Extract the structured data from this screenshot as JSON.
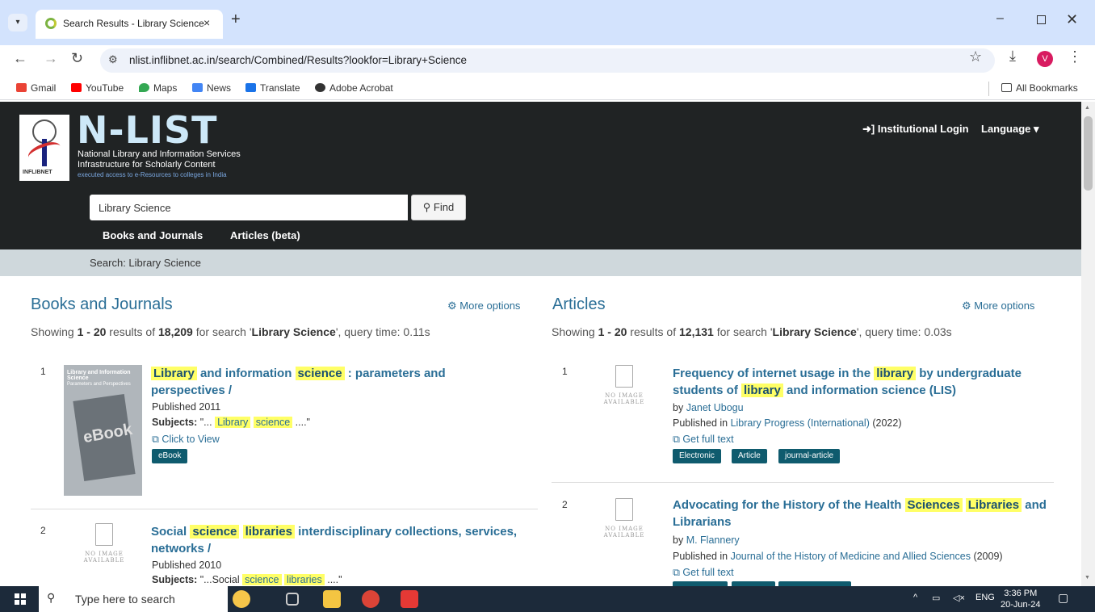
{
  "browser": {
    "tab_title": "Search Results - Library Science",
    "tab_close": "×",
    "new_tab": "+",
    "url": "nlist.inflibnet.ac.in/search/Combined/Results?lookfor=Library+Science",
    "profile_initial": "V",
    "bookmarks": [
      "Gmail",
      "YouTube",
      "Maps",
      "News",
      "Translate",
      "Adobe Acrobat"
    ],
    "all_bookmarks": "All Bookmarks"
  },
  "site": {
    "brand": "N-LIST",
    "tagline1": "National Library and Information Services",
    "tagline2": "Infrastructure for Scholarly Content",
    "tagline3": "executed access to e-Resources to colleges in India",
    "logo_text": "INFLIBNET",
    "login": "Institutional Login",
    "language": "Language",
    "search_value": "Library Science",
    "find": "Find",
    "tabs": [
      "Books and Journals",
      "Articles (beta)"
    ],
    "breadcrumb": "Search: Library Science"
  },
  "books": {
    "title": "Books and Journals",
    "more_options": "More options",
    "showing_prefix": "Showing ",
    "range": "1 - 20",
    "results_of": " results of ",
    "total": "18,209",
    "for_search": " for search '",
    "query": "Library Science",
    "time": "', query time: 0.11s",
    "results": [
      {
        "num": "1",
        "title_parts": [
          "Library",
          " and information ",
          "science",
          " : parameters and perspectives /"
        ],
        "published": "Published 2011",
        "subjects_label": "Subjects:",
        "subjects_pre": " \"... ",
        "subj_hl1": "Library",
        "subj_hl2": "science",
        "subjects_post": " ....\"",
        "link": "Click to View",
        "badge": "eBook",
        "cover_title": "Library and Information Science",
        "cover_sub": "Parameters and Perspectives",
        "cover_word": "eBook"
      },
      {
        "num": "2",
        "title_parts": [
          "Social ",
          "science",
          " ",
          "libraries",
          " interdisciplinary collections, services, networks /"
        ],
        "published": "Published 2010",
        "subjects_label": "Subjects:",
        "subjects_pre": " \"...Social ",
        "subj_hl1": "science",
        "subj_hl2": "libraries",
        "subjects_post": " ....\"",
        "noimg": [
          "NO IMAGE",
          "AVAILABLE"
        ]
      }
    ]
  },
  "articles": {
    "title": "Articles",
    "more_options": "More options",
    "showing_prefix": "Showing ",
    "range": "1 - 20",
    "results_of": " results of ",
    "total": "12,131",
    "for_search": " for search '",
    "query": "Library Science",
    "time": "', query time: 0.03s",
    "results": [
      {
        "num": "1",
        "title_parts": [
          "Frequency of internet usage in the ",
          "library",
          " by undergraduate students of ",
          "library",
          " and information science (LIS)"
        ],
        "by": "by ",
        "author": "Janet Ubogu",
        "published_in": "Published in ",
        "journal": "Library Progress (International)",
        "year": " (2022)",
        "link": "Get full text",
        "badges": [
          "Electronic",
          "Article",
          "journal-article"
        ],
        "noimg": [
          "NO IMAGE",
          "AVAILABLE"
        ]
      },
      {
        "num": "2",
        "title_parts": [
          "Advocating for the History of the Health ",
          "Sciences",
          " ",
          "Libraries",
          " and Librarians"
        ],
        "by": "by ",
        "author": "M. Flannery",
        "published_in": "Published in ",
        "journal": "Journal of the History of Medicine and Allied Sciences",
        "year": " (2009)",
        "link": "Get full text",
        "noimg": [
          "NO IMAGE",
          "AVAILABLE"
        ]
      }
    ]
  },
  "taskbar": {
    "search_placeholder": "Type here to search",
    "lang": "ENG",
    "time": "3:36 PM",
    "date": "20-Jun-24"
  }
}
